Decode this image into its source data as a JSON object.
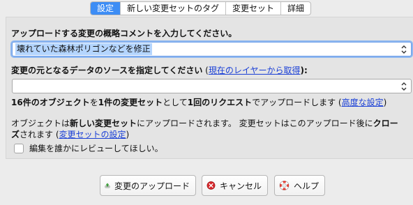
{
  "tabs": [
    "設定",
    "新しい変更セットのタグ",
    "変更セット",
    "詳細"
  ],
  "comment": {
    "label": "アップロードする変更の概略コメントを入力してください。",
    "value": "壊れていた森林ポリゴンなどを修正"
  },
  "source": {
    "label": "変更の元となるデータのソースを指定してください",
    "link": "現在のレイヤーから取得",
    "paren_open": " (",
    "paren_close": "):",
    "value": ""
  },
  "summary": {
    "p1": "16件のオブジェクト",
    "p2": "を",
    "p3": "1件の変更セット",
    "p4": "として",
    "p5": "1回のリクエスト",
    "p6": "でアップロードします (",
    "link": "高度な設定",
    "p7": ")"
  },
  "info": {
    "line1_a": "オブジェクトは",
    "line1_b": "新しい変更セット",
    "line1_c": "にアップロードされます。 変更セットはこのアップロード後に",
    "line1_d": "クロー",
    "line2_a": "ズ",
    "line2_b": "されます (",
    "link": "変更セットの設定",
    "line2_c": ")"
  },
  "review_checkbox": {
    "label": "編集を誰かにレビューしてほしい。",
    "checked": false
  },
  "buttons": {
    "upload": "変更のアップロード",
    "cancel": "キャンセル",
    "help": "ヘルプ"
  },
  "icons": {
    "upload": "upload-icon",
    "cancel": "cancel-icon",
    "help": "help-lifebuoy-icon"
  }
}
